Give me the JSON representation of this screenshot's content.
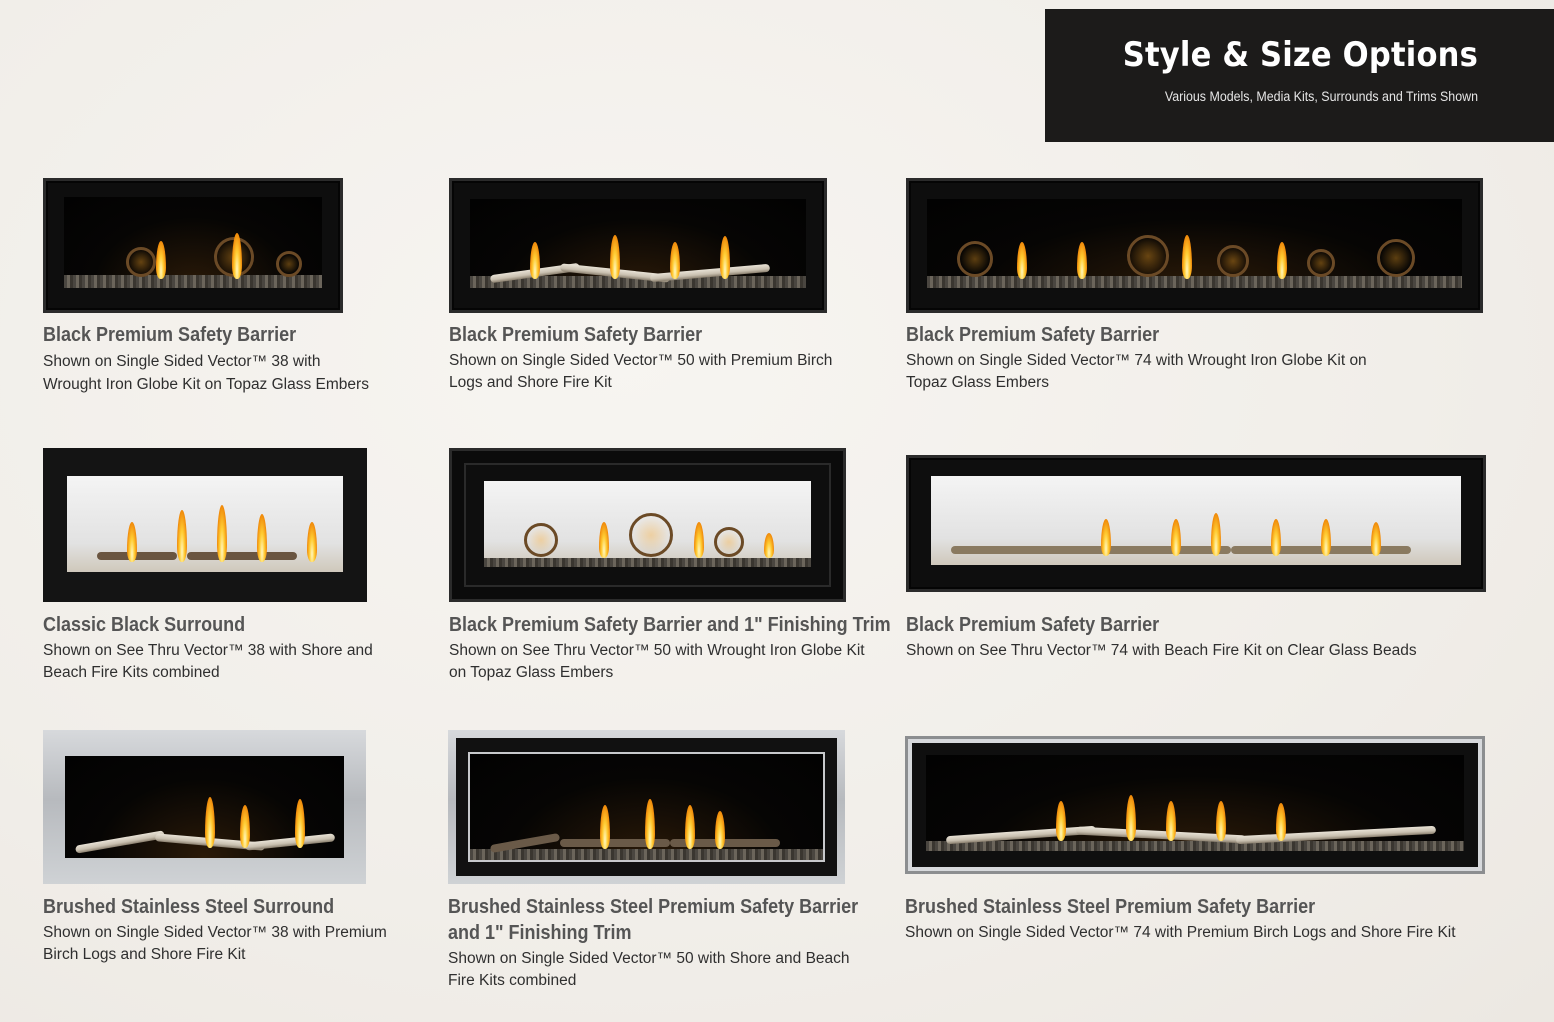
{
  "header": {
    "title": "Style & Size Options",
    "subtitle": "Various Models, Media Kits, Surrounds and Trims Shown"
  },
  "items": [
    {
      "title": "Black Premium Safety Barrier",
      "line1": "Shown on Single Sided Vector™ 38 with",
      "line2": "Wrought Iron Globe Kit on Topaz Glass Embers"
    },
    {
      "title": "Black Premium Safety Barrier",
      "line1": "Shown on Single Sided Vector™ 50 with Premium Birch",
      "line2": "Logs and Shore Fire Kit"
    },
    {
      "title": "Black Premium Safety Barrier",
      "line1": "Shown on Single Sided Vector™ 74 with Wrought Iron Globe Kit on",
      "line2": "Topaz Glass Embers"
    },
    {
      "title": "Classic Black Surround",
      "line1": "Shown on See Thru Vector™ 38 with Shore and",
      "line2": "Beach Fire Kits combined"
    },
    {
      "title": "Black Premium Safety Barrier and 1\" Finishing Trim",
      "line1": "Shown on See Thru Vector™ 50 with Wrought Iron Globe Kit",
      "line2": "on Topaz Glass Embers"
    },
    {
      "title": "Black Premium Safety Barrier",
      "line1": "Shown on See Thru Vector™ 74 with Beach Fire Kit on Clear Glass Beads",
      "line2": ""
    },
    {
      "title": "Brushed Stainless Steel Surround",
      "line1": "Shown on Single Sided Vector™ 38 with Premium",
      "line2": "Birch Logs and Shore Fire Kit"
    },
    {
      "title": "Brushed Stainless Steel Premium Safety Barrier",
      "title2": "and 1\" Finishing Trim",
      "line1": "Shown on Single Sided Vector™ 50 with Shore and Beach",
      "line2": "Fire Kits combined"
    },
    {
      "title": "Brushed Stainless Steel Premium Safety Barrier",
      "line1": "Shown on Single Sided Vector™ 74 with Premium Birch Logs and Shore Fire Kit",
      "line2": ""
    }
  ]
}
